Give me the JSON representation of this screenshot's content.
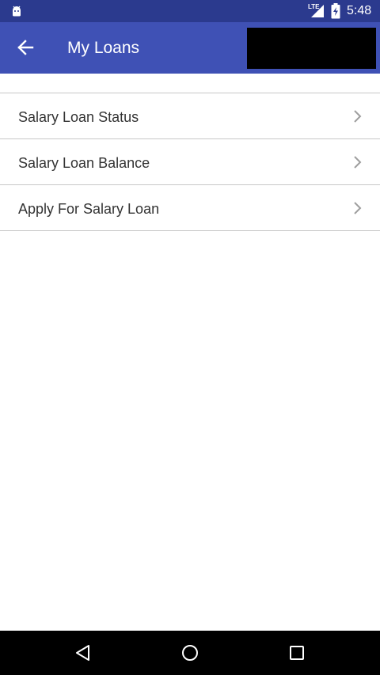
{
  "status_bar": {
    "network_label": "LTE",
    "time": "5:48",
    "background_color": "#2b3a8e",
    "icons": [
      "android-icon",
      "signal-icon",
      "battery-icon"
    ]
  },
  "app_bar": {
    "title": "My Loans",
    "back_icon": "arrow-left-icon",
    "background_color": "#3f51b5"
  },
  "menu": {
    "items": [
      {
        "label": "Salary Loan Status",
        "icon": "chevron-right-icon"
      },
      {
        "label": "Salary Loan Balance",
        "icon": "chevron-right-icon"
      },
      {
        "label": "Apply For Salary Loan",
        "icon": "chevron-right-icon"
      }
    ]
  },
  "nav_bar": {
    "buttons": [
      "nav-back-icon",
      "nav-home-icon",
      "nav-recents-icon"
    ],
    "background_color": "#000000"
  }
}
